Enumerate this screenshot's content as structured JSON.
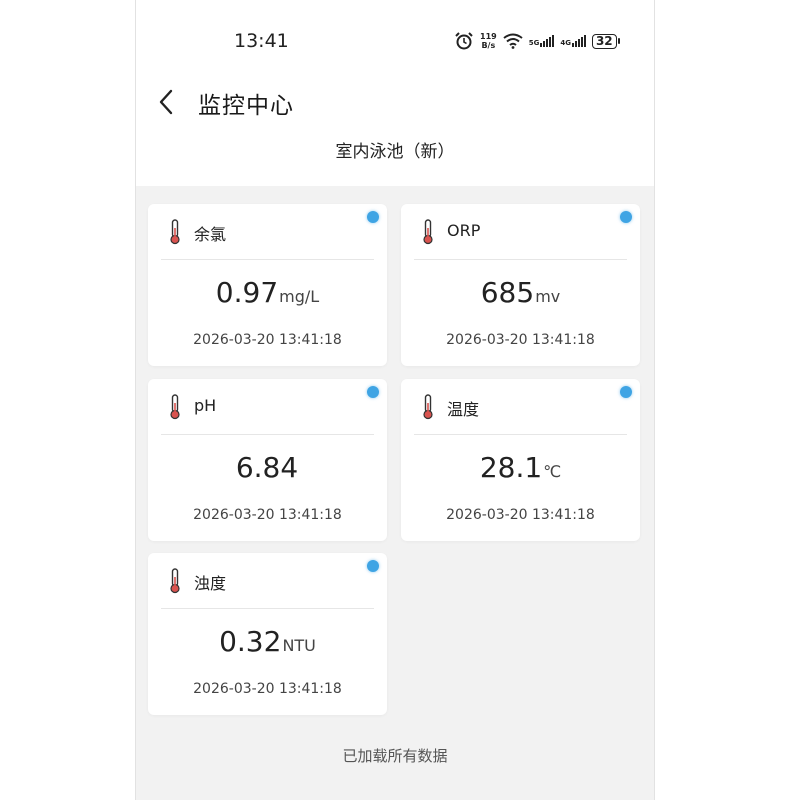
{
  "status_bar": {
    "time": "13:41",
    "net_speed_value": "119",
    "net_speed_unit": "B/s",
    "signal_1_label": "5G",
    "signal_2_label": "4G",
    "battery": "32",
    "icons": [
      "alarm-icon",
      "wifi-icon",
      "signal-icon",
      "battery-icon"
    ]
  },
  "header": {
    "title": "监控中心",
    "subtitle": "室内泳池（新）"
  },
  "cards": [
    {
      "name": "余氯",
      "value": "0.97",
      "unit": "mg/L",
      "timestamp": "2026-03-20 13:41:18"
    },
    {
      "name": "ORP",
      "value": "685",
      "unit": "mv",
      "timestamp": "2026-03-20 13:41:18"
    },
    {
      "name": "pH",
      "value": "6.84",
      "unit": "",
      "timestamp": "2026-03-20 13:41:18"
    },
    {
      "name": "温度",
      "value": "28.1",
      "unit": "℃",
      "timestamp": "2026-03-20 13:41:18"
    },
    {
      "name": "浊度",
      "value": "0.32",
      "unit": "NTU",
      "timestamp": "2026-03-20 13:41:18"
    }
  ],
  "footer": {
    "text": "已加载所有数据"
  },
  "colors": {
    "status_dot": "#3fa4e4",
    "thermometer_bulb": "#d9534f",
    "page_background": "#f2f2f2"
  }
}
